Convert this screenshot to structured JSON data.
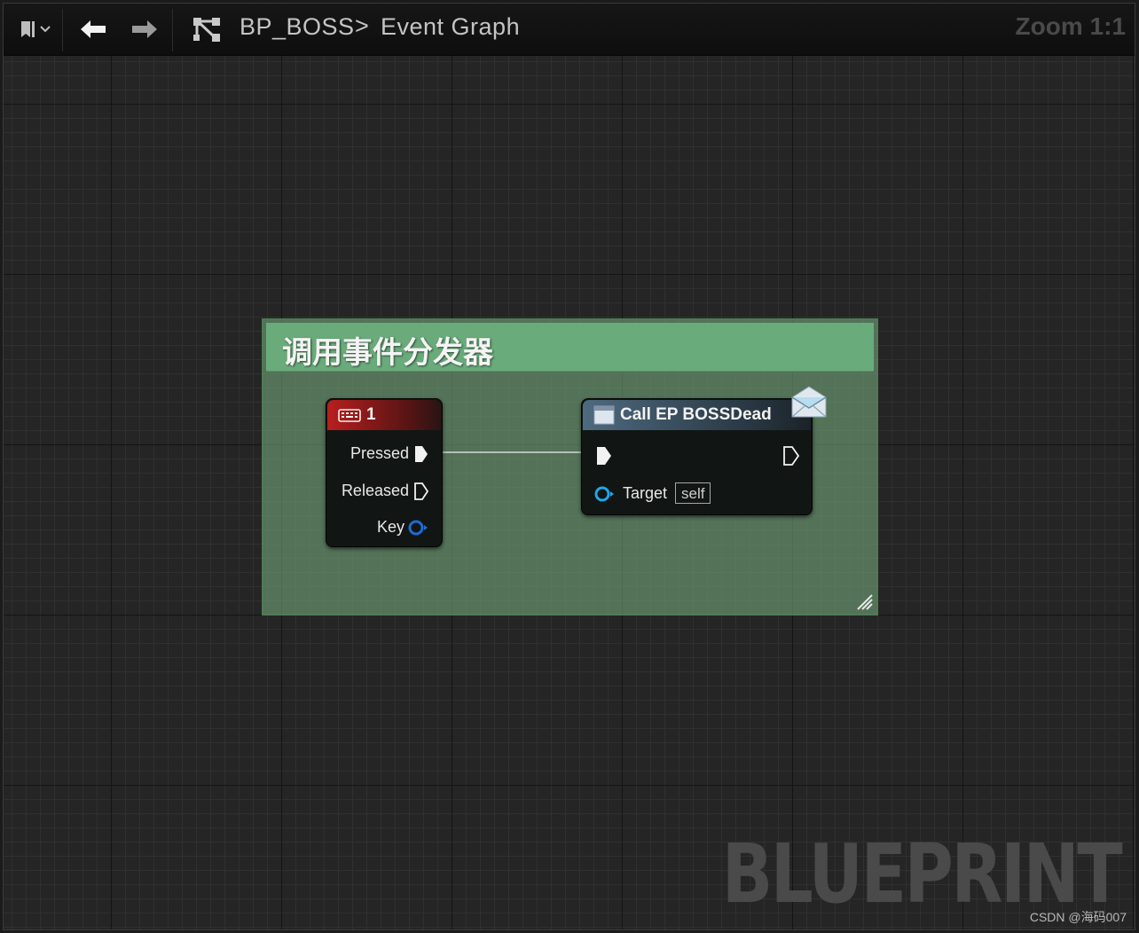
{
  "toolbar": {
    "bookmark_icon": "bookmark-icon",
    "back_icon": "arrow-left-icon",
    "forward_icon": "arrow-right-icon",
    "graph_icon": "graph-hierarchy-icon"
  },
  "breadcrumb": {
    "blueprint": "BP_BOSS",
    "separator": ">",
    "graph": "Event Graph"
  },
  "zoom_label": "Zoom 1:1",
  "comment": {
    "title": "调用事件分发器",
    "color": "#6aab7b"
  },
  "key_event_node": {
    "title": "1",
    "icon": "keyboard-icon",
    "header_color": "#8a1414",
    "pins": {
      "pressed": "Pressed",
      "released": "Released",
      "key": "Key"
    }
  },
  "call_node": {
    "title": "Call EP BOSSDead",
    "icon": "function-icon",
    "badge_icon": "envelope-icon",
    "header_color": "#3e5566",
    "pins": {
      "target": "Target",
      "target_default": "self"
    }
  },
  "watermark": "BLUEPRINT",
  "credit": "CSDN @海码007"
}
